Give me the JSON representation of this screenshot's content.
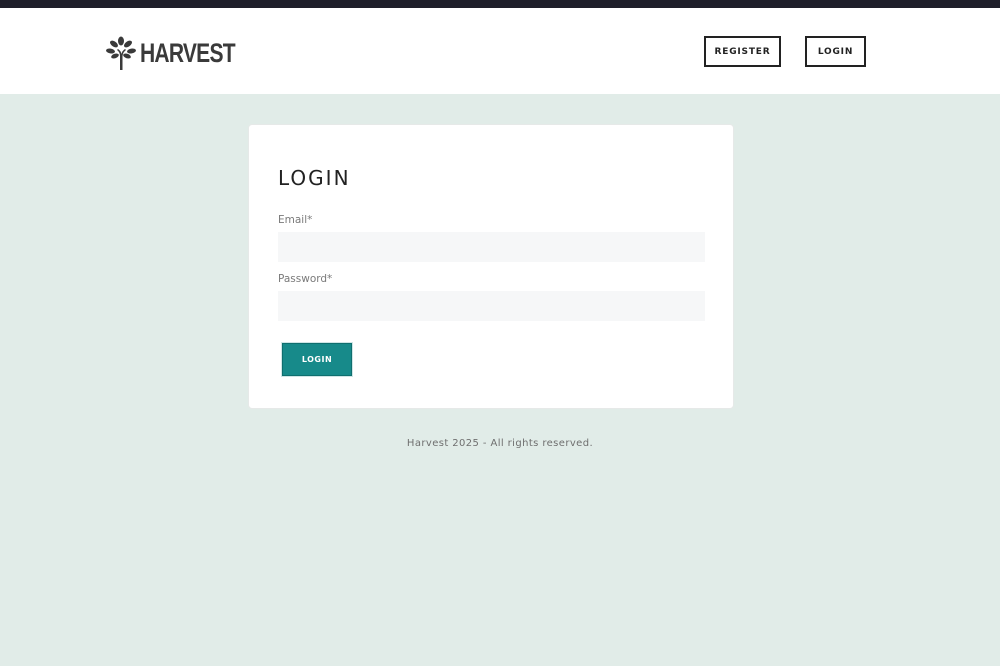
{
  "brand": {
    "name": "HARVEST",
    "logo_icon": "tree-icon"
  },
  "nav": {
    "register_label": "REGISTER",
    "login_label": "LOGIN"
  },
  "form": {
    "title": "LOGIN",
    "email_label": "Email*",
    "email_value": "",
    "password_label": "Password*",
    "password_value": "",
    "submit_label": "LOGIN"
  },
  "footer": {
    "text": "Harvest 2025 - All rights reserved."
  },
  "colors": {
    "page_background": "#e1ece8",
    "top_strip": "#1f1f2a",
    "accent": "#178a8a",
    "text_dark": "#222222"
  }
}
